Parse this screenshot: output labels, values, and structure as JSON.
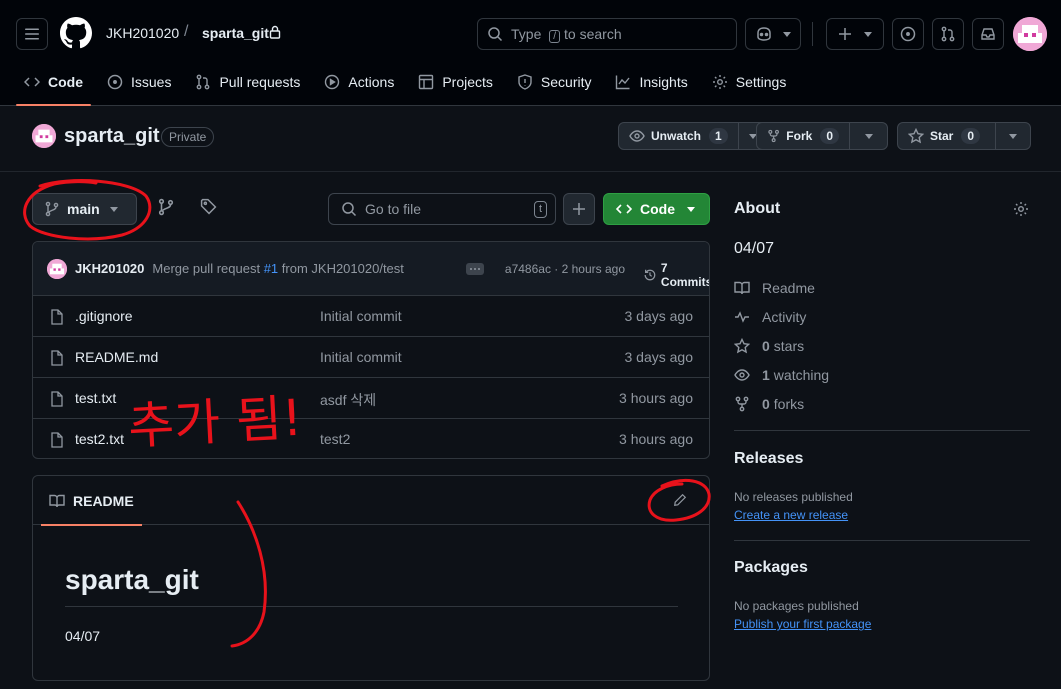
{
  "header": {
    "owner": "JKH201020",
    "separator": "/",
    "repo": "sparta_git",
    "search_placeholder": "Type",
    "search_key": "/",
    "search_suffix": "to search"
  },
  "nav": [
    {
      "label": "Code",
      "icon": "code-icon",
      "active": true
    },
    {
      "label": "Issues",
      "icon": "issue-icon"
    },
    {
      "label": "Pull requests",
      "icon": "pull-request-icon"
    },
    {
      "label": "Actions",
      "icon": "play-icon"
    },
    {
      "label": "Projects",
      "icon": "table-icon"
    },
    {
      "label": "Security",
      "icon": "shield-icon"
    },
    {
      "label": "Insights",
      "icon": "graph-icon"
    },
    {
      "label": "Settings",
      "icon": "gear-icon"
    }
  ],
  "repo_header": {
    "name": "sparta_git",
    "visibility": "Private",
    "watch_label": "Unwatch",
    "watch_count": "1",
    "fork_label": "Fork",
    "fork_count": "0",
    "star_label": "Star",
    "star_count": "0"
  },
  "toolbar": {
    "branch": "main",
    "goto_placeholder": "Go to file",
    "goto_key": "t",
    "code_label": "Code"
  },
  "commit": {
    "author": "JKH201020",
    "message_pre": "Merge pull request",
    "pr": "#1",
    "message_post": "from JKH201020/test",
    "meta": "a7486ac · 2 hours ago",
    "count_label": "7 Commits"
  },
  "files": [
    {
      "name": ".gitignore",
      "message": "Initial commit",
      "date": "3 days ago"
    },
    {
      "name": "README.md",
      "message": "Initial commit",
      "date": "3 days ago"
    },
    {
      "name": "test.txt",
      "message": "asdf 삭제",
      "date": "3 hours ago"
    },
    {
      "name": "test2.txt",
      "message": "test2",
      "date": "3 hours ago"
    }
  ],
  "readme": {
    "tab_label": "README",
    "heading": "sparta_git",
    "body": "04/07"
  },
  "sidebar": {
    "about_title": "About",
    "description": "04/07",
    "readme_label": "Readme",
    "activity_label": "Activity",
    "stars_count": "0",
    "stars_label": "stars",
    "watching_count": "1",
    "watching_label": "watching",
    "forks_count": "0",
    "forks_label": "forks",
    "releases_title": "Releases",
    "releases_note": "No releases published",
    "releases_link": "Create a new release",
    "packages_title": "Packages",
    "packages_note": "No packages published",
    "packages_link": "Publish your first package"
  },
  "annotation": {
    "text": "추가 됨!",
    "color": "#e8121b"
  },
  "colors": {
    "accent_green": "#238636",
    "link_blue": "#4493f8",
    "tab_underline": "#f78166",
    "background": "#0d1117"
  }
}
